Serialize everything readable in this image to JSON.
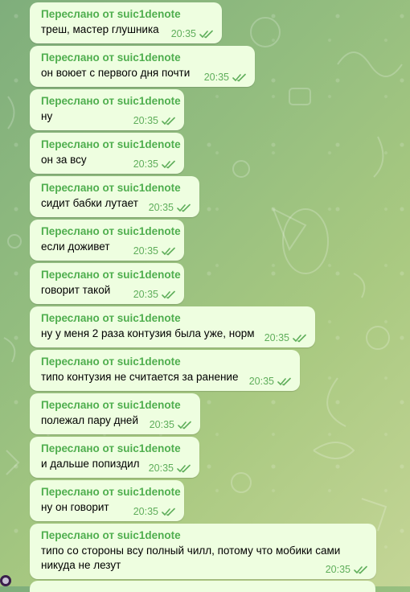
{
  "chat": {
    "messages": [
      {
        "forwarded_from": "Переслано от suic1denote",
        "text": [
          "треш, мастер глушника"
        ],
        "time": "20:35"
      },
      {
        "forwarded_from": "Переслано от suic1denote",
        "text": [
          "он воюет с первого дня почти"
        ],
        "time": "20:35"
      },
      {
        "forwarded_from": "Переслано от suic1denote",
        "text": [
          "ну"
        ],
        "time": "20:35"
      },
      {
        "forwarded_from": "Переслано от suic1denote",
        "text": [
          "он за всу"
        ],
        "time": "20:35"
      },
      {
        "forwarded_from": "Переслано от suic1denote",
        "text": [
          "сидит бабки лутает"
        ],
        "time": "20:35"
      },
      {
        "forwarded_from": "Переслано от suic1denote",
        "text": [
          "если доживет"
        ],
        "time": "20:35"
      },
      {
        "forwarded_from": "Переслано от suic1denote",
        "text": [
          "говорит такой"
        ],
        "time": "20:35"
      },
      {
        "forwarded_from": "Переслано от suic1denote",
        "text": [
          "ну у меня 2 раза контузия была уже, норм"
        ],
        "time": "20:35"
      },
      {
        "forwarded_from": "Переслано от suic1denote",
        "text": [
          "типо контузия не считается за ранение"
        ],
        "time": "20:35"
      },
      {
        "forwarded_from": "Переслано от suic1denote",
        "text": [
          "полежал пару дней"
        ],
        "time": "20:35"
      },
      {
        "forwarded_from": "Переслано от suic1denote",
        "text": [
          "и дальше попиздил"
        ],
        "time": "20:35"
      },
      {
        "forwarded_from": "Переслано от suic1denote",
        "text": [
          "ну он говорит"
        ],
        "time": "20:35"
      },
      {
        "forwarded_from": "Переслано от suic1denote",
        "text": [
          "типо со стороны всу полный чилл, потому что мобики сами",
          "никуда не лезут"
        ],
        "time": "20:35"
      }
    ]
  },
  "colors": {
    "bubble": "#eefee0",
    "forward_label": "#4fae4e",
    "meta": "#5fae5b"
  },
  "icons": {
    "read_status": "double-check-icon"
  }
}
